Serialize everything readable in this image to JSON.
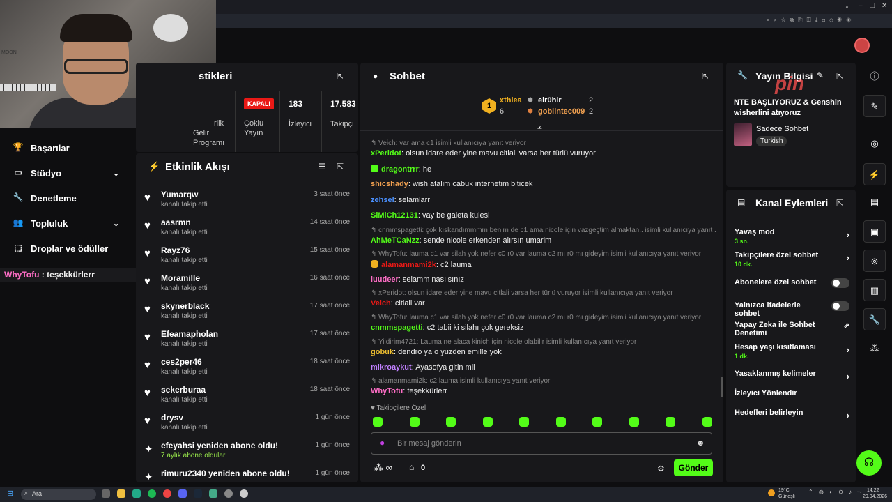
{
  "webcam": {
    "alt": "MOON"
  },
  "leftnav": {
    "items": [
      {
        "label": "Başarılar",
        "icon": "trophy-icon"
      },
      {
        "label": "Stüdyo",
        "icon": "studio-icon",
        "expand": true
      },
      {
        "label": "Denetleme",
        "icon": "wrench-icon"
      },
      {
        "label": "Topluluk",
        "icon": "community-icon",
        "expand": true
      },
      {
        "label": "Droplar ve ödüller",
        "icon": "drops-icon"
      }
    ],
    "overlay_user": "WhyTofu",
    "overlay_sep": " : ",
    "overlay_msg": "teşekkürlerr"
  },
  "stats": {
    "title": "stikleri",
    "gelir_a": "rlik",
    "gelir_b": "Gelir",
    "gelir_c": "Programı",
    "kapali": "KAPALI",
    "coklu_a": "Çoklu",
    "coklu_b": "Yayın",
    "viewers": "183",
    "viewers_label": "İzleyici",
    "followers": "17.583",
    "followers_label": "Takipçi"
  },
  "activity": {
    "title": "Etkinlik Akışı",
    "rows": [
      {
        "name": "Yumarqw",
        "sub": "kanalı takip etti",
        "time": "3 saat önce",
        "icon": "heart-icon"
      },
      {
        "name": "aasrmn",
        "sub": "kanalı takip etti",
        "time": "14 saat önce",
        "icon": "heart-icon"
      },
      {
        "name": "Rayz76",
        "sub": "kanalı takip etti",
        "time": "15 saat önce",
        "icon": "heart-icon"
      },
      {
        "name": "Moramille",
        "sub": "kanalı takip etti",
        "time": "16 saat önce",
        "icon": "heart-icon"
      },
      {
        "name": "skynerblack",
        "sub": "kanalı takip etti",
        "time": "17 saat önce",
        "icon": "heart-icon"
      },
      {
        "name": "Efeamapholan",
        "sub": "kanalı takip etti",
        "time": "17 saat önce",
        "icon": "heart-icon"
      },
      {
        "name": "ces2per46",
        "sub": "kanalı takip etti",
        "time": "18 saat önce",
        "icon": "heart-icon"
      },
      {
        "name": "sekerburaa",
        "sub": "kanalı takip etti",
        "time": "18 saat önce",
        "icon": "heart-icon"
      },
      {
        "name": "drysv",
        "sub": "kanalı takip etti",
        "time": "1 gün önce",
        "icon": "heart-icon"
      },
      {
        "name": "efeyahsi yeniden abone oldu!",
        "sub": "7 aylık abone oldular",
        "time": "1 gün önce",
        "icon": "sparkle-icon",
        "green": true
      },
      {
        "name": "rimuru2340 yeniden abone oldu!",
        "sub": "",
        "time": "1 gün önce",
        "icon": "sparkle-icon"
      }
    ]
  },
  "chat": {
    "title": "Sohbet",
    "leaders": {
      "first": "xthiea",
      "first_count": "6",
      "rank": "1",
      "second": "elr0hir",
      "second_count": "2",
      "third": "goblintec009",
      "third_count": "2"
    },
    "lines": [
      {
        "type": "reply",
        "text": "Veich: var ama c1 isimli kullanıcıya yanıt veriyor"
      },
      {
        "type": "msg",
        "user": "xPeridot",
        "color": "#53fc18",
        "text": "olsun idare eder yine mavu citlali varsa her türlü vuruyor"
      },
      {
        "type": "msg",
        "user": "dragontrrr",
        "color": "#53fc18",
        "text": "he",
        "badge": true
      },
      {
        "type": "msg",
        "user": "shicshady",
        "color": "#f0a050",
        "text": "wish atalim cabuk internetim biticek"
      },
      {
        "type": "msg",
        "user": "zehsel",
        "color": "#4a90ff",
        "text": "selamlarr"
      },
      {
        "type": "msg",
        "user": "SiMiCh12131",
        "color": "#53fc18",
        "text": "vay be galeta kulesi"
      },
      {
        "type": "reply",
        "text": "cnmmspagetti: çok kıskandımmmm benim de c1 ama nicole için vazgeçtim almaktan.. isimli kullanıcıya yanıt ..."
      },
      {
        "type": "msg",
        "user": "AhMeTCaNzz",
        "color": "#53fc18",
        "text": "sende nicole erkenden alırsın umarim"
      },
      {
        "type": "reply",
        "text": "WhyTofu: lauma c1 var silah yok nefer c0 r0 var lauma c2 mı r0 mı gideyim isimli kullanıcıya yanıt veriyor"
      },
      {
        "type": "msg",
        "user": "alamanmami2k",
        "color": "#e91916",
        "text": "c2 lauma",
        "badge": true
      },
      {
        "type": "msg",
        "user": "luudeer",
        "color": "#ff6ec7",
        "text": "selamm nasılsınız"
      },
      {
        "type": "reply",
        "text": "xPeridot: olsun idare eder yine mavu citlali varsa her türlü vuruyor isimli kullanıcıya yanıt veriyor"
      },
      {
        "type": "msg",
        "user": "Veich",
        "color": "#e91916",
        "text": "citlali var"
      },
      {
        "type": "reply",
        "text": "WhyTofu: lauma c1 var silah yok nefer c0 r0 var lauma c2 mı r0 mı gideyim isimli kullanıcıya yanıt veriyor"
      },
      {
        "type": "msg",
        "user": "cnmmspagetti",
        "color": "#53fc18",
        "text": "c2 tabii ki silahı çok gereksiz"
      },
      {
        "type": "reply",
        "text": "Yildirim4721: Lauma ne alaca kinich için nicole olabilir isimli kullanıcıya yanıt veriyor"
      },
      {
        "type": "msg",
        "user": "gobuk",
        "color": "#f0c030",
        "text": "dendro ya o yuzden emille yok"
      },
      {
        "type": "msg",
        "user": "mikroaykut",
        "color": "#c080ff",
        "text": "Ayasofya gitin mii"
      },
      {
        "type": "reply",
        "text": "alamanmami2k: c2 lauma isimli kullanıcıya yanıt veriyor"
      },
      {
        "type": "msg",
        "user": "WhyTofu",
        "color": "#ff6ec7",
        "text": "teşekkürlerr"
      }
    ],
    "followers_only": "Takipçilere Özel",
    "placeholder": "Bir mesaj gönderin",
    "count": "0",
    "send": "Gönder"
  },
  "stream": {
    "title": "Yayın Bilgisi",
    "watermark": "pin",
    "desc": "NTE BAŞLIYORUZ & Genshin wisherlini atıyoruz",
    "category": "Sadece Sohbet",
    "tag": "Turkish"
  },
  "channel": {
    "title": "Kanal Eylemleri",
    "rows": [
      {
        "label": "Yavaş mod",
        "value": "3 sn.",
        "kind": "arrow"
      },
      {
        "label": "Takipçilere özel sohbet",
        "value": "10 dk.",
        "kind": "arrow"
      },
      {
        "label": "Abonelere özel sohbet",
        "value": "",
        "kind": "toggle"
      },
      {
        "label": "Yalnızca ifadelerle sohbet",
        "value": "",
        "kind": "toggle"
      },
      {
        "label": "Yapay Zeka ile Sohbet Denetimi",
        "value": "",
        "kind": "external"
      },
      {
        "label": "Hesap yaşı kısıtlaması",
        "value": "1 dk.",
        "kind": "arrow"
      },
      {
        "label": "Yasaklanmış kelimeler",
        "value": "",
        "kind": "arrow"
      },
      {
        "label": "İzleyici Yönlendir",
        "value": "",
        "kind": "none"
      },
      {
        "label": "Hedefleri belirleyin",
        "value": "",
        "kind": "arrow"
      }
    ]
  },
  "taskbar": {
    "search": "Ara",
    "weather_temp": "19°C",
    "weather_desc": "Güneşli",
    "time": "14:22",
    "date": "29.04.2026"
  },
  "colors": {
    "accent": "#53fc18",
    "panel": "#18181b",
    "bg": "#0e0e10"
  }
}
